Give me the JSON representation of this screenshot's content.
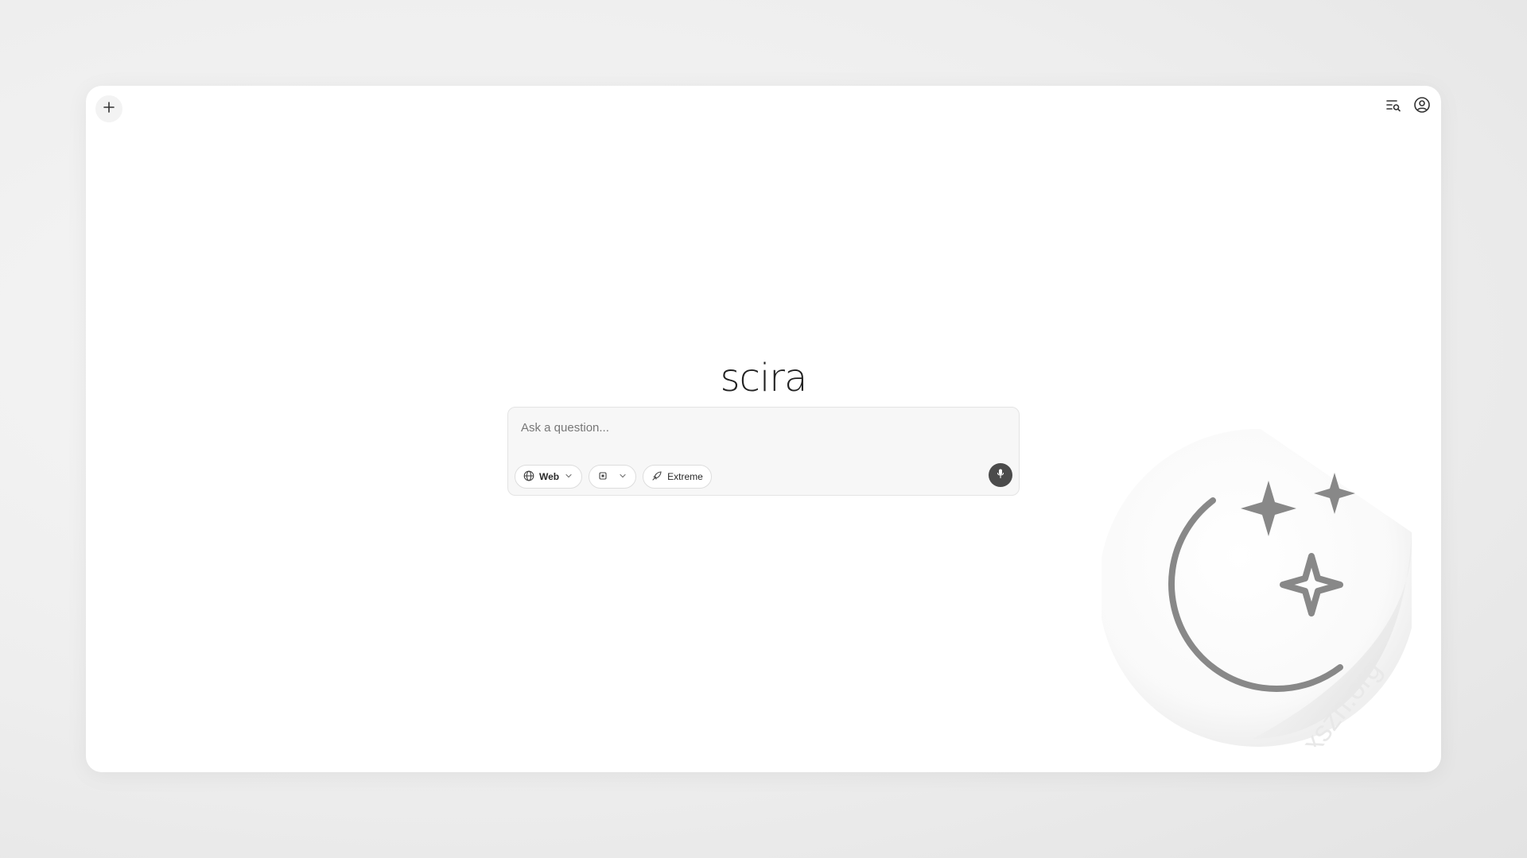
{
  "app": {
    "brand": "scira"
  },
  "header": {
    "new_chat_icon": "plus-icon",
    "history_icon": "search-history-icon",
    "account_icon": "user-circle-icon"
  },
  "composer": {
    "placeholder": "Ask a question...",
    "value": "",
    "search_mode": {
      "icon": "globe-icon",
      "label": "Web"
    },
    "model_selector": {
      "icon": "cpu-icon",
      "label": ""
    },
    "extreme_mode": {
      "icon": "rocket-icon",
      "label": "Extreme"
    },
    "voice_icon": "mic-icon"
  },
  "watermark": {
    "text": "xszn.org",
    "icon": "moon-stars-icon"
  },
  "colors": {
    "window_bg": "#ffffff",
    "page_bg": "#eeeeee",
    "composer_bg": "#f7f7f7",
    "mic_bg": "#4b4b4b",
    "text": "#1f1f1f"
  }
}
